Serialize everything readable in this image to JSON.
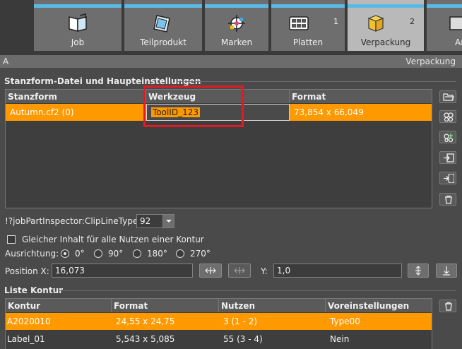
{
  "tabs": [
    {
      "label": "Job",
      "icon": "job-icon"
    },
    {
      "label": "Teilprodukt",
      "icon": "part-product-icon"
    },
    {
      "label": "Marken",
      "icon": "marks-icon"
    },
    {
      "label": "Platten",
      "num": "1",
      "icon": "plates-icon"
    },
    {
      "label": "Verpackung",
      "num": "2",
      "icon": "packaging-icon"
    },
    {
      "label": "An",
      "icon": "next-icon"
    }
  ],
  "header": {
    "left": "A",
    "right": "Verpackung"
  },
  "stanz": {
    "title": "Stanzform-Datei und Haupteinstellungen",
    "columns": [
      "Stanzform",
      "Werkzeug",
      "Format"
    ],
    "rows": [
      {
        "stanzform": "Autumn.cf2 (0)",
        "werkzeug": "ToolID_123",
        "format": "73,854 x 66,049"
      }
    ]
  },
  "clip": {
    "label": "!?jobPartInspector:ClipLineType",
    "value": "92"
  },
  "same_content": {
    "label": "Gleicher Inhalt für alle Nutzen einer Kontur",
    "checked": false
  },
  "orientation": {
    "label": "Ausrichtung:",
    "options": [
      "0°",
      "90°",
      "180°",
      "270°"
    ],
    "selected": "0°"
  },
  "position": {
    "x_label": "Position X:",
    "x_value": "16,073",
    "y_label": "Y:",
    "y_value": "1,0"
  },
  "kontur": {
    "title": "Liste Kontur",
    "columns": [
      "Kontur",
      "Format",
      "Nutzen",
      "Voreinstellungen"
    ],
    "rows": [
      {
        "kontur": "A2020010",
        "format": "24,55 x 24,75",
        "nutzen": "3 (1 - 2)",
        "voreinstellungen": "Type00",
        "selected": true
      },
      {
        "kontur": "Label_01",
        "format": "5,543 x 5,085",
        "nutzen": "55 (3 - 4)",
        "voreinstellungen": "Nein",
        "selected": false
      }
    ]
  },
  "colors": {
    "accent": "#ff9900",
    "tab_stripe": "#5bb9e6",
    "highlight": "#e01b24"
  }
}
